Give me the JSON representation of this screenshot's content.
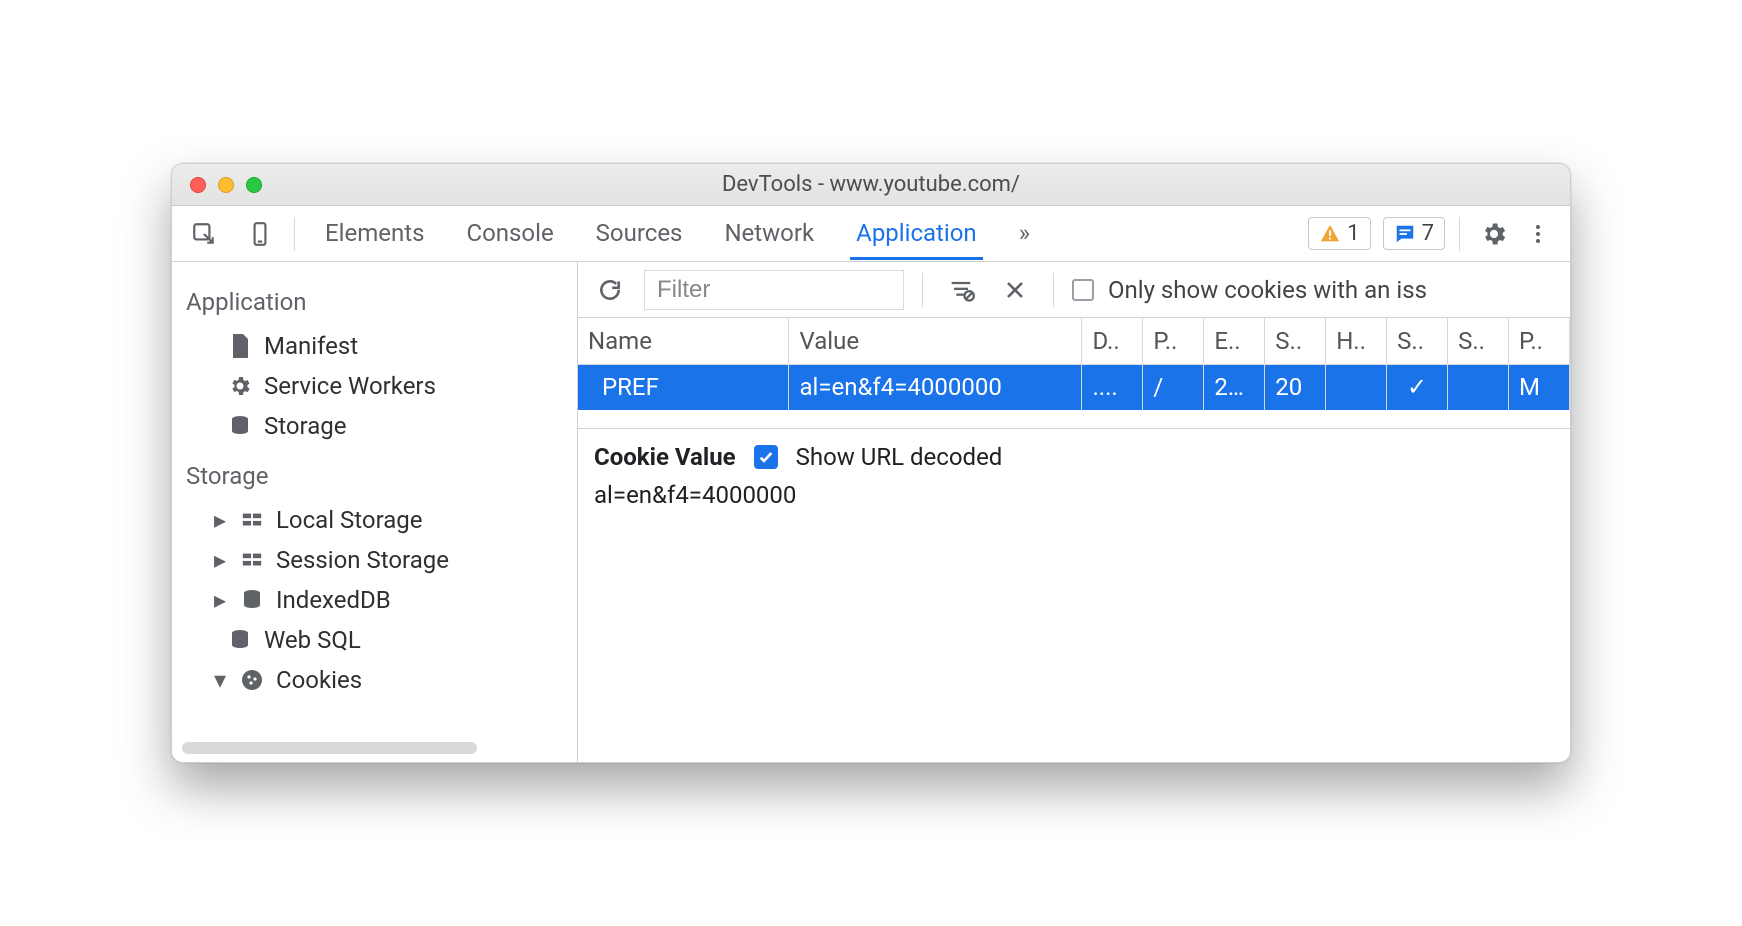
{
  "window_title": "DevTools - www.youtube.com/",
  "tabs": {
    "t0": "Elements",
    "t1": "Console",
    "t2": "Sources",
    "t3": "Network",
    "t4": "Application"
  },
  "badges": {
    "warn_count": "1",
    "msg_count": "7"
  },
  "sidebar": {
    "app_section": "Application",
    "manifest": "Manifest",
    "service_workers": "Service Workers",
    "storage": "Storage",
    "storage_section": "Storage",
    "local_storage": "Local Storage",
    "session_storage": "Session Storage",
    "indexeddb": "IndexedDB",
    "websql": "Web SQL",
    "cookies": "Cookies"
  },
  "filter": {
    "placeholder": "Filter",
    "only_issues": "Only show cookies with an iss"
  },
  "table": {
    "headers": {
      "name": "Name",
      "value": "Value",
      "d": "D..",
      "p": "P..",
      "e": "E..",
      "s": "S..",
      "h": "H..",
      "s2": "S..",
      "s3": "S..",
      "pr": "P.."
    },
    "row": {
      "name": "PREF",
      "value": "al=en&f4=4000000",
      "d": "....",
      "p": "/",
      "e": "2…",
      "s": "20",
      "h": "",
      "s2": "✓",
      "s3": "",
      "pr": "M"
    }
  },
  "cookie_pane": {
    "title": "Cookie Value",
    "check_label": "Show URL decoded",
    "value": "al=en&f4=4000000"
  }
}
